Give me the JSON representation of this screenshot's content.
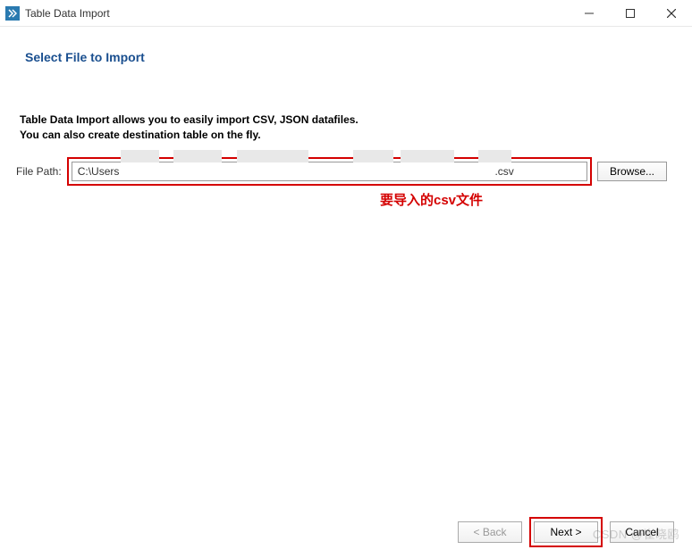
{
  "window": {
    "title": "Table Data Import"
  },
  "heading": "Select File to Import",
  "description_line1": "Table Data Import allows you to easily import CSV, JSON datafiles.",
  "description_line2": "You can also create destination table on the fly.",
  "file": {
    "label": "File Path:",
    "value_prefix": "C:\\Users",
    "value_suffix": ".csv"
  },
  "browse_label": "Browse...",
  "annotation": "要导入的csv文件",
  "buttons": {
    "back": "< Back",
    "next": "Next >",
    "cancel": "Cancel"
  },
  "watermark": "CSDN @崔晓鸥"
}
